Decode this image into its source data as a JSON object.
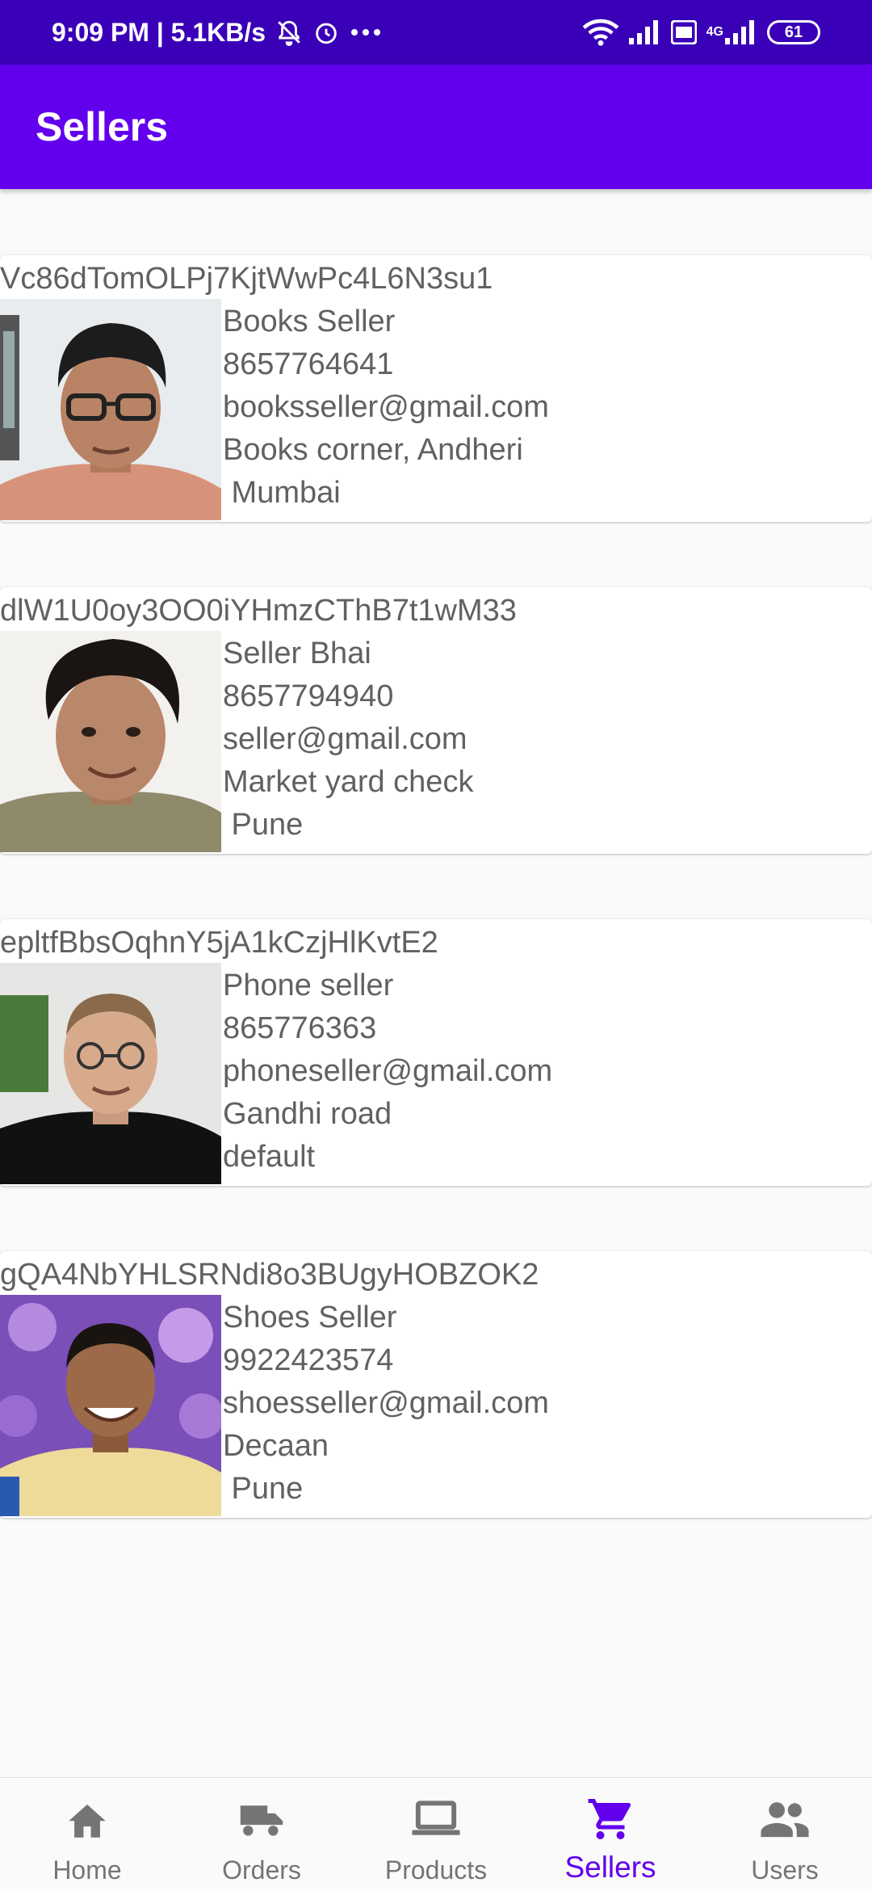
{
  "status_bar": {
    "time": "9:09 PM | 5.1KB/s",
    "battery": "61",
    "network_label": "4G"
  },
  "app_bar": {
    "title": "Sellers"
  },
  "sellers": [
    {
      "id": "Vc86dTomOLPj7KjtWwPc4L6N3su1",
      "name": "Books Seller",
      "phone": "8657764641",
      "email": "booksseller@gmail.com",
      "address": "Books corner, Andheri",
      "city": " Mumbai"
    },
    {
      "id": "dlW1U0oy3OO0iYHmzCThB7t1wM33",
      "name": "Seller Bhai",
      "phone": "8657794940",
      "email": "seller@gmail.com",
      "address": "Market yard check",
      "city": " Pune"
    },
    {
      "id": "epltfBbsOqhnY5jA1kCzjHlKvtE2",
      "name": "Phone seller",
      "phone": "865776363",
      "email": "phoneseller@gmail.com",
      "address": "Gandhi road",
      "city": "default"
    },
    {
      "id": "gQA4NbYHLSRNdi8o3BUgyHOBZOK2",
      "name": "Shoes Seller",
      "phone": "9922423574",
      "email": "shoesseller@gmail.com",
      "address": "Decaan",
      "city": " Pune"
    }
  ],
  "bottom_nav": {
    "items": [
      {
        "label": "Home",
        "icon": "home-icon"
      },
      {
        "label": "Orders",
        "icon": "truck-icon"
      },
      {
        "label": "Products",
        "icon": "laptop-icon"
      },
      {
        "label": "Sellers",
        "icon": "cart-icon"
      },
      {
        "label": "Users",
        "icon": "users-icon"
      }
    ],
    "active": "Sellers"
  },
  "colors": {
    "primary": "#6200ee",
    "status_bar": "#3a00b8",
    "text_secondary": "#616161",
    "nav_inactive": "#757575"
  }
}
